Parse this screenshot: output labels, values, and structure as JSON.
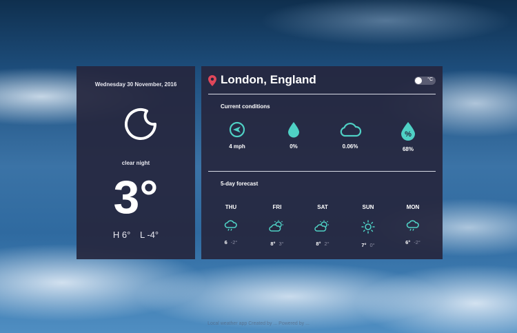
{
  "summary": {
    "date": "Wednesday 30 November, 2016",
    "condition": "clear night",
    "temperature": "3°",
    "high": "H 6°",
    "low": "L -4°",
    "icon": "moon-icon"
  },
  "location": {
    "name": "London, England",
    "unit_label": "°C"
  },
  "current": {
    "title": "Current conditions",
    "items": [
      {
        "icon": "wind-compass-icon",
        "value": "4 mph"
      },
      {
        "icon": "raindrop-icon",
        "value": "0%"
      },
      {
        "icon": "cloud-icon",
        "value": "0.06%"
      },
      {
        "icon": "humidity-icon",
        "value": "68%"
      }
    ]
  },
  "forecast": {
    "title": "5-day forecast",
    "days": [
      {
        "day": "THU",
        "high": "6",
        "low": "-2°",
        "icon": "cloud-rain-icon"
      },
      {
        "day": "FRI",
        "high": "8°",
        "low": "3°",
        "icon": "partly-cloudy-icon"
      },
      {
        "day": "SAT",
        "high": "8°",
        "low": "2°",
        "icon": "partly-cloudy-icon"
      },
      {
        "day": "SUN",
        "high": "7°",
        "low": "0°",
        "icon": "sun-icon"
      },
      {
        "day": "MON",
        "high": "6°",
        "low": "-2°",
        "icon": "cloud-rain-icon"
      }
    ]
  },
  "footer": {
    "text": "Local weather app Created by ... Powered by ..."
  },
  "colors": {
    "accent": "#4fd1c5",
    "pin": "#e0475a",
    "panel": "#26273e"
  }
}
